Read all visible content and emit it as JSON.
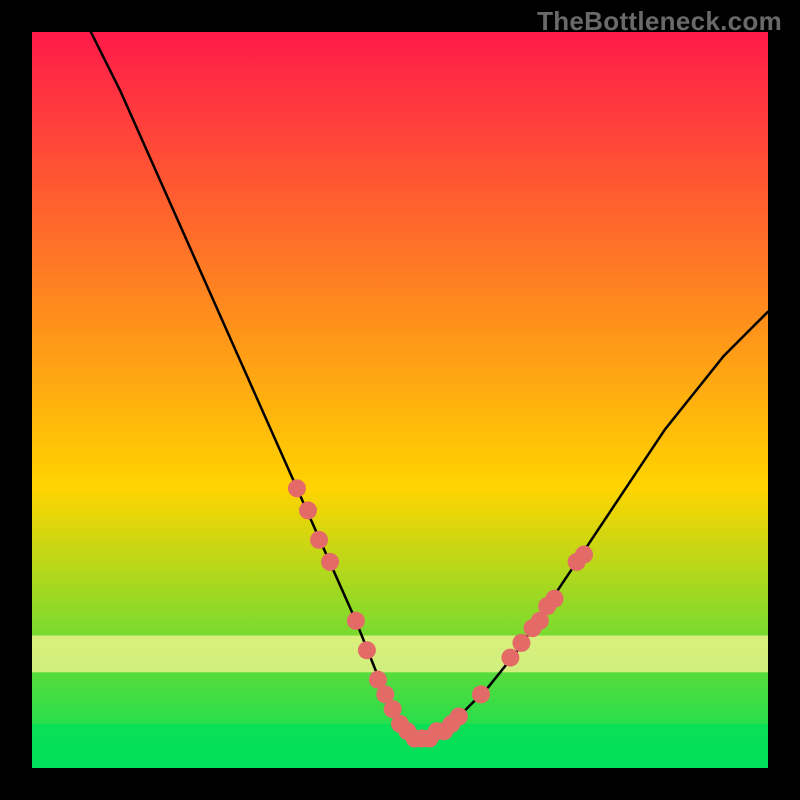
{
  "watermark": "TheBottleneck.com",
  "chart_data": {
    "type": "line",
    "title": "",
    "xlabel": "",
    "ylabel": "",
    "xlim": [
      0,
      100
    ],
    "ylim": [
      0,
      100
    ],
    "grid": false,
    "legend": false,
    "background_gradient": {
      "top": "#ff1a4a",
      "mid": "#ffd400",
      "bottom": "#00e05a"
    },
    "series": [
      {
        "name": "bottleneck-curve",
        "x": [
          8,
          12,
          16,
          20,
          24,
          28,
          32,
          36,
          40,
          44,
          46,
          48,
          50,
          52,
          54,
          56,
          58,
          62,
          66,
          70,
          74,
          78,
          82,
          86,
          90,
          94,
          98,
          100
        ],
        "y_pct": [
          100,
          92,
          83,
          74,
          65,
          56,
          47,
          38,
          29,
          20,
          15,
          10,
          6,
          4,
          4,
          5,
          7,
          11,
          16,
          22,
          28,
          34,
          40,
          46,
          51,
          56,
          60,
          62
        ]
      }
    ],
    "markers": {
      "name": "highlight-dots",
      "color": "#e46a68",
      "points": [
        {
          "x": 36.0,
          "y_pct": 38
        },
        {
          "x": 37.5,
          "y_pct": 35
        },
        {
          "x": 39.0,
          "y_pct": 31
        },
        {
          "x": 40.5,
          "y_pct": 28
        },
        {
          "x": 44.0,
          "y_pct": 20
        },
        {
          "x": 45.5,
          "y_pct": 16
        },
        {
          "x": 47.0,
          "y_pct": 12
        },
        {
          "x": 48.0,
          "y_pct": 10
        },
        {
          "x": 49.0,
          "y_pct": 8
        },
        {
          "x": 50.0,
          "y_pct": 6
        },
        {
          "x": 51.0,
          "y_pct": 5
        },
        {
          "x": 52.0,
          "y_pct": 4
        },
        {
          "x": 53.0,
          "y_pct": 4
        },
        {
          "x": 54.0,
          "y_pct": 4
        },
        {
          "x": 55.0,
          "y_pct": 5
        },
        {
          "x": 56.0,
          "y_pct": 5
        },
        {
          "x": 57.0,
          "y_pct": 6
        },
        {
          "x": 58.0,
          "y_pct": 7
        },
        {
          "x": 61.0,
          "y_pct": 10
        },
        {
          "x": 65.0,
          "y_pct": 15
        },
        {
          "x": 66.5,
          "y_pct": 17
        },
        {
          "x": 68.0,
          "y_pct": 19
        },
        {
          "x": 69.0,
          "y_pct": 20
        },
        {
          "x": 70.0,
          "y_pct": 22
        },
        {
          "x": 71.0,
          "y_pct": 23
        },
        {
          "x": 74.0,
          "y_pct": 28
        },
        {
          "x": 75.0,
          "y_pct": 29
        }
      ]
    },
    "bands": [
      {
        "name": "yellow-band",
        "y_from_pct": 18,
        "y_to_pct": 13,
        "color": "#fff799"
      },
      {
        "name": "green-band",
        "y_from_pct": 6,
        "y_to_pct": 0.5,
        "color": "#00e05a"
      }
    ]
  }
}
